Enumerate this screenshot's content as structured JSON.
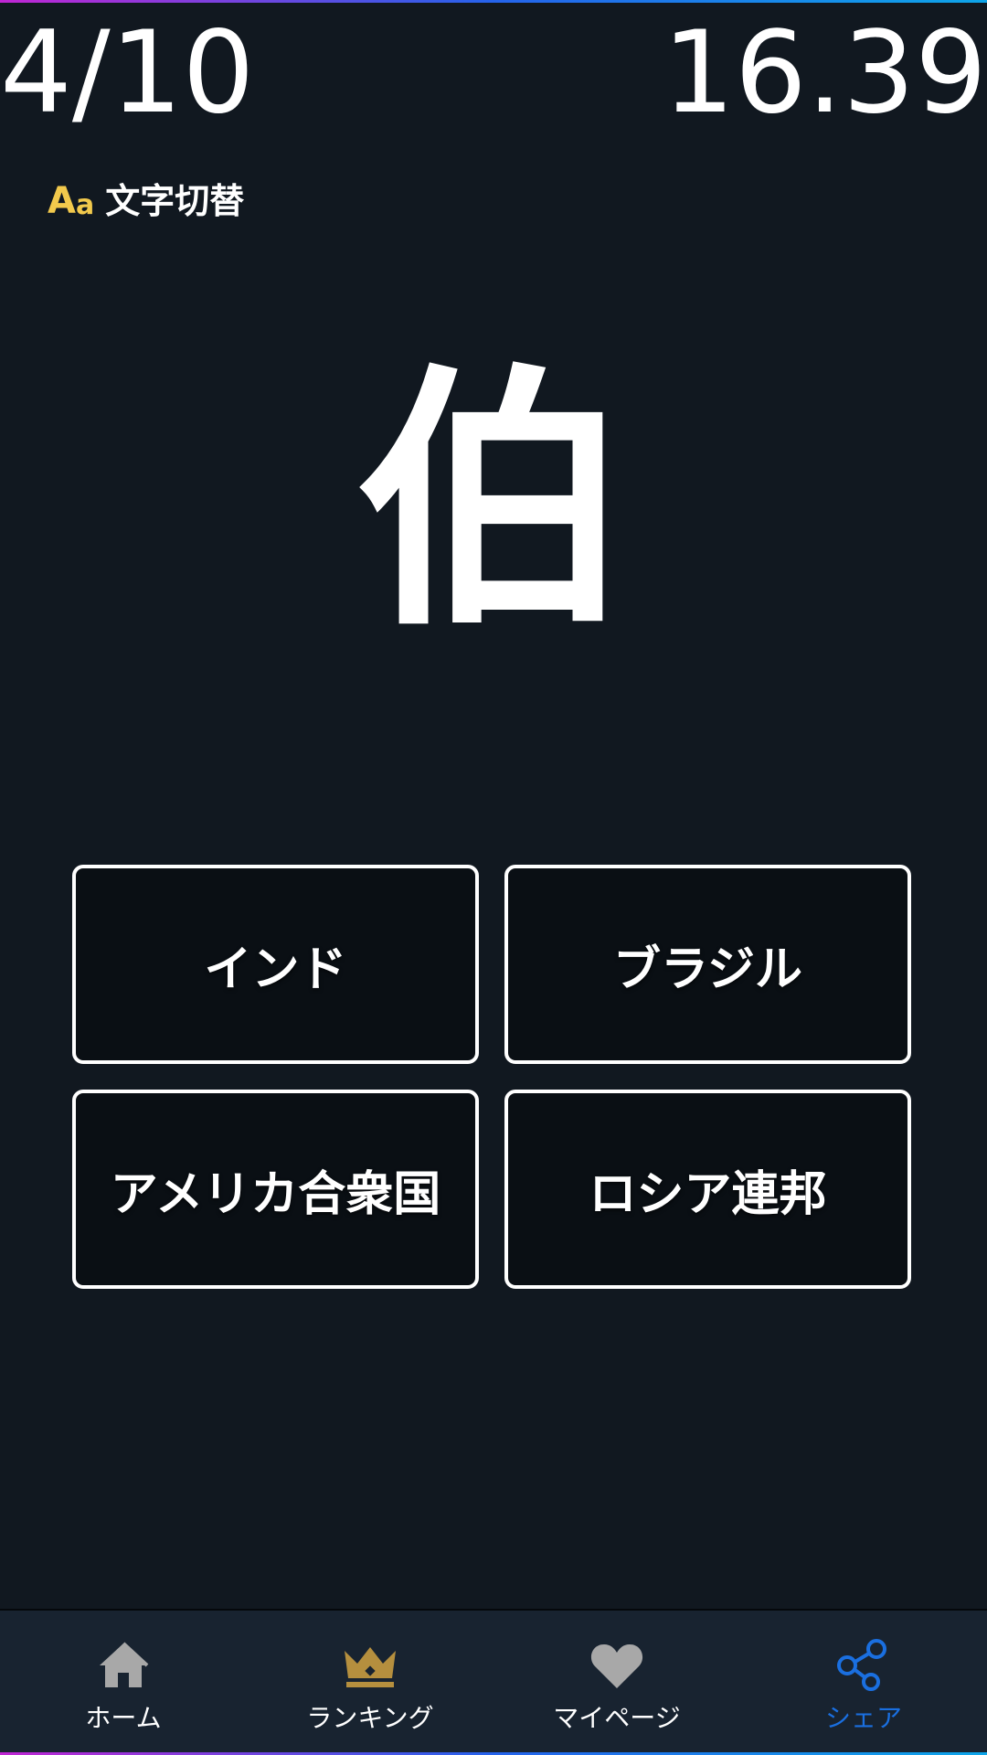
{
  "header": {
    "progress": "4/10",
    "timer": "16.39"
  },
  "font_toggle": {
    "icon": "Aa",
    "icon_big": "A",
    "icon_small": "a",
    "label": "文字切替"
  },
  "question": {
    "kanji": "伯"
  },
  "answers": [
    {
      "label": "インド"
    },
    {
      "label": "ブラジル"
    },
    {
      "label": "アメリカ合衆国"
    },
    {
      "label": "ロシア連邦"
    }
  ],
  "nav": {
    "items": [
      {
        "label": "ホーム",
        "icon": "home-icon"
      },
      {
        "label": "ランキング",
        "icon": "crown-icon"
      },
      {
        "label": "マイページ",
        "icon": "heart-icon"
      },
      {
        "label": "シェア",
        "icon": "share-icon",
        "active": true
      }
    ]
  },
  "colors": {
    "background": "#111820",
    "accent_yellow": "#f2c94c",
    "nav_background": "#182330",
    "active_blue": "#1a6fe0",
    "crown_gold": "#b58f3e",
    "icon_gray": "#a8a8a8"
  }
}
